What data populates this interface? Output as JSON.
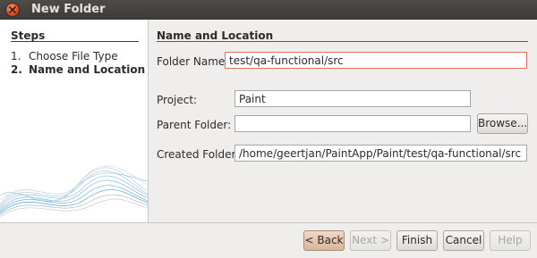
{
  "window": {
    "title": "New Folder"
  },
  "steps": {
    "heading": "Steps",
    "items": [
      {
        "num": "1.",
        "label": "Choose File Type"
      },
      {
        "num": "2.",
        "label": "Name and Location"
      }
    ]
  },
  "main": {
    "heading": "Name and Location",
    "folder_name": {
      "label": "Folder Name:",
      "value": "test/qa-functional/src"
    },
    "project": {
      "label": "Project:",
      "value": "Paint"
    },
    "parent_folder": {
      "label": "Parent Folder:",
      "value": ""
    },
    "browse_label": "Browse...",
    "created_folder": {
      "label": "Created Folder:",
      "value": "/home/geertjan/PaintApp/Paint/test/qa-functional/src"
    }
  },
  "buttons": {
    "back": "< Back",
    "next": "Next >",
    "finish": "Finish",
    "cancel": "Cancel",
    "help": "Help"
  },
  "colors": {
    "focus_border": "#e0705a",
    "titlebar": "#3c3b37",
    "wave": "#4aa6d6"
  }
}
